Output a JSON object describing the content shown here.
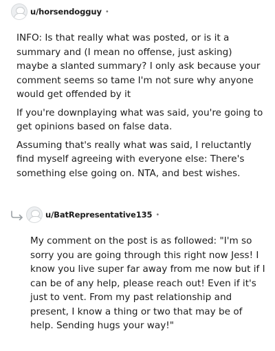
{
  "comments": [
    {
      "username": "u/horsendogguy",
      "separator": "•",
      "paragraphs": [
        "INFO: Is that really what was posted, or is it a summary and (I mean no offense, just asking) maybe a slanted summary? I only ask because your comment seems so tame I'm not sure why anyone would get offended by it",
        "If you're downplaying what was said, you're going to get opinions based on false data.",
        "Assuming that's really what was said, I reluctantly find myself agreeing with everyone else: There's something else going on. NTA, and best wishes."
      ]
    },
    {
      "username": "u/BatRepresentative135",
      "separator": "•",
      "paragraphs": [
        "My comment on the post is as followed: \"I'm so sorry you are going through this right now Jess! I know you live super far away from me now but if I can be of any help, please reach out! Even if it's just to vent. From my past relationship and present, I know a thing or two that may be of help. Sending hugs your way!\""
      ]
    }
  ],
  "icons": {
    "avatar": "default-user-avatar-icon",
    "reply": "reply-arrow-icon"
  },
  "colors": {
    "text": "#1c1c1c",
    "meta": "#7c7c7c",
    "avatar_bg": "#edeff1"
  }
}
